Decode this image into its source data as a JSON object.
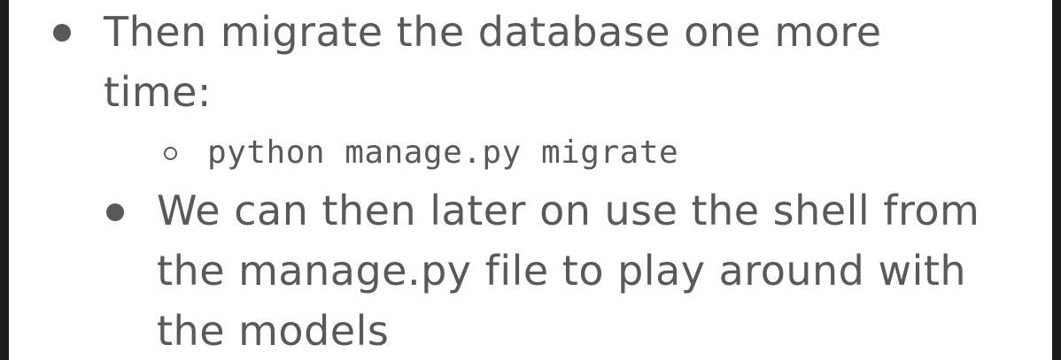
{
  "bullets": [
    {
      "lines": [
        "Then migrate the database one more",
        "time:"
      ]
    },
    {
      "lines": [
        "We can then later on use the shell from",
        "the manage.py file to play around with",
        "the models"
      ]
    }
  ],
  "sub_bullet": {
    "code": "python manage.py migrate"
  },
  "colors": {
    "text": "#595959",
    "background": "#ffffff",
    "frame": "#1c1c1c"
  }
}
